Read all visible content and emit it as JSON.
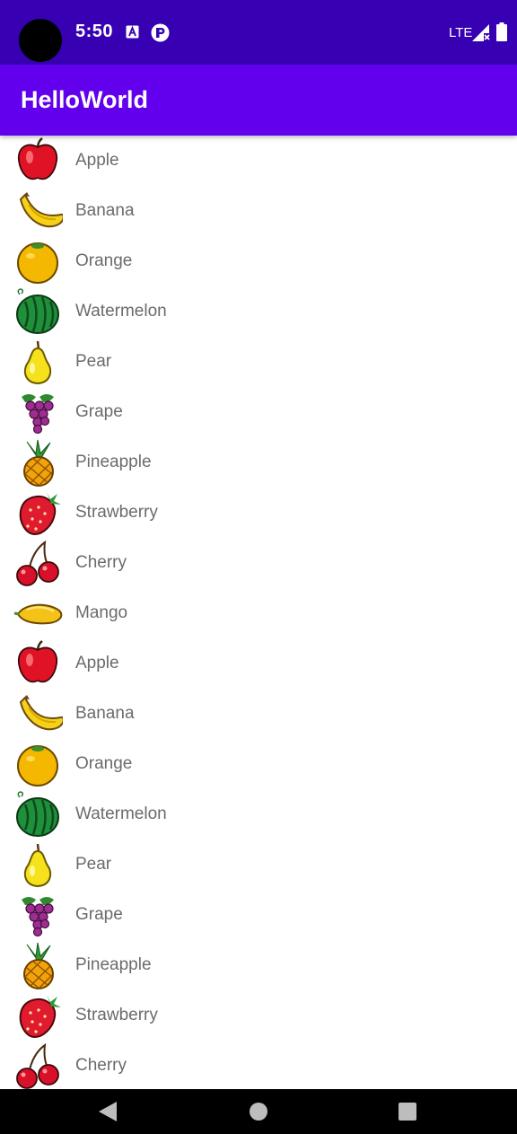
{
  "status_bar": {
    "time": "5:50",
    "network": "LTE",
    "icons": [
      "camera-hole",
      "a-notification-icon",
      "p-notification-icon",
      "signal-icon",
      "battery-icon"
    ]
  },
  "app_bar": {
    "title": "HelloWorld"
  },
  "fruit_list": {
    "items": [
      {
        "name": "Apple",
        "icon": "apple-icon"
      },
      {
        "name": "Banana",
        "icon": "banana-icon"
      },
      {
        "name": "Orange",
        "icon": "orange-icon"
      },
      {
        "name": "Watermelon",
        "icon": "watermelon-icon"
      },
      {
        "name": "Pear",
        "icon": "pear-icon"
      },
      {
        "name": "Grape",
        "icon": "grape-icon"
      },
      {
        "name": "Pineapple",
        "icon": "pineapple-icon"
      },
      {
        "name": "Strawberry",
        "icon": "strawberry-icon"
      },
      {
        "name": "Cherry",
        "icon": "cherry-icon"
      },
      {
        "name": "Mango",
        "icon": "mango-icon"
      },
      {
        "name": "Apple",
        "icon": "apple-icon"
      },
      {
        "name": "Banana",
        "icon": "banana-icon"
      },
      {
        "name": "Orange",
        "icon": "orange-icon"
      },
      {
        "name": "Watermelon",
        "icon": "watermelon-icon"
      },
      {
        "name": "Pear",
        "icon": "pear-icon"
      },
      {
        "name": "Grape",
        "icon": "grape-icon"
      },
      {
        "name": "Pineapple",
        "icon": "pineapple-icon"
      },
      {
        "name": "Strawberry",
        "icon": "strawberry-icon"
      },
      {
        "name": "Cherry",
        "icon": "cherry-icon"
      }
    ]
  },
  "navigation_bar": {
    "buttons": [
      "back-icon",
      "home-icon",
      "recents-icon"
    ]
  },
  "colors": {
    "status_bar": "#3700b3",
    "app_bar": "#6200ee",
    "item_text": "#6b6b6b",
    "nav_bar": "#000000"
  }
}
